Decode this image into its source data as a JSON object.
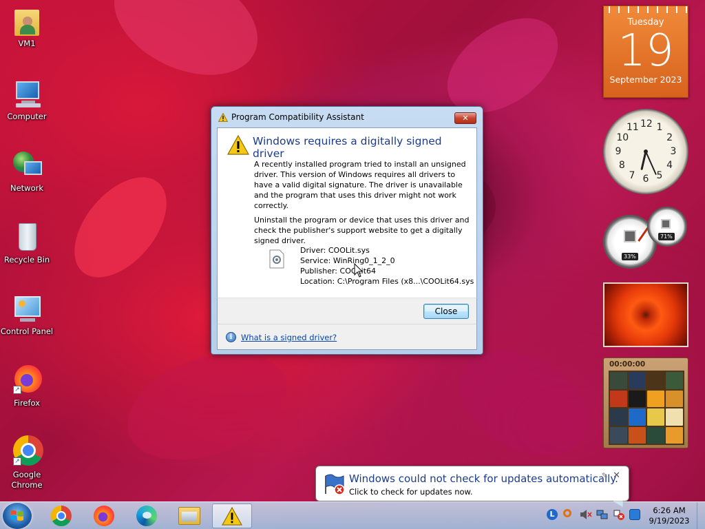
{
  "desktop": {
    "icons": [
      {
        "label": "VM1"
      },
      {
        "label": "Computer"
      },
      {
        "label": "Network"
      },
      {
        "label": "Recycle Bin"
      },
      {
        "label": "Control Panel"
      },
      {
        "label": "Firefox"
      },
      {
        "label": "Google Chrome"
      }
    ]
  },
  "dialog": {
    "title": "Program Compatibility Assistant",
    "close_glyph": "✕",
    "heading": "Windows requires a digitally signed driver",
    "paragraph1": "A recently installed program tried to install an unsigned driver. This version of Windows requires all drivers to have a valid digital signature. The driver is unavailable and the program that uses this driver might not work correctly.",
    "paragraph2": "Uninstall the program or device that uses this driver and check the publisher's support website to get a digitally signed driver.",
    "driver": "Driver: COOLit.sys",
    "service": "Service: WinRing0_1_2_0",
    "publisher": "Publisher: COOLit64",
    "location": "Location: C:\\Program Files (x8...\\COOLit64.sys",
    "close_button": "Close",
    "help_link": "What is a signed driver?",
    "info_glyph": "i"
  },
  "gadgets": {
    "calendar": {
      "weekday": "Tuesday",
      "day": "19",
      "month_year": "September 2023"
    },
    "clock": {
      "numerals": [
        "12",
        "1",
        "2",
        "3",
        "4",
        "5",
        "6",
        "7",
        "8",
        "9",
        "10",
        "11"
      ]
    },
    "meters": {
      "cpu": "33%",
      "memory": "71%"
    },
    "puzzle": {
      "timer": "00:00:00"
    }
  },
  "notification": {
    "title": "Windows could not check for updates automatically.",
    "body": "Click to check for updates now.",
    "close_glyph": "✕"
  },
  "taskbar": {
    "time": "6:26 AM",
    "date": "9/19/2023"
  },
  "colors": {
    "heading_blue": "#1b3c8c",
    "link_blue": "#0645ad",
    "calendar_orange": "#e8742a"
  }
}
